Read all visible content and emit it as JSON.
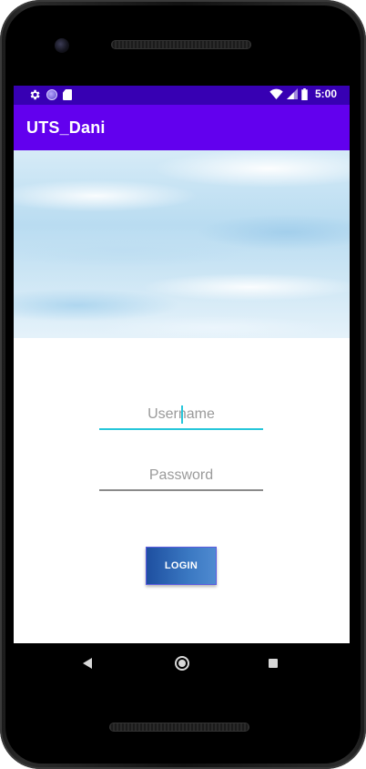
{
  "statusbar": {
    "icons": [
      "gear-icon",
      "circle-icon",
      "sd-card-icon",
      "wifi-icon",
      "signal-icon",
      "battery-icon"
    ],
    "time": "5:00",
    "color": "#3700b3"
  },
  "appbar": {
    "title": "UTS_Dani",
    "color": "#6200ee"
  },
  "form": {
    "username_placeholder": "Username",
    "username_value": "",
    "password_placeholder": "Password",
    "password_value": "",
    "focus_color": "#26c6da",
    "login_label": "LOGIN"
  },
  "navbar": {
    "icons": [
      "back-icon",
      "home-icon",
      "recents-icon"
    ]
  }
}
